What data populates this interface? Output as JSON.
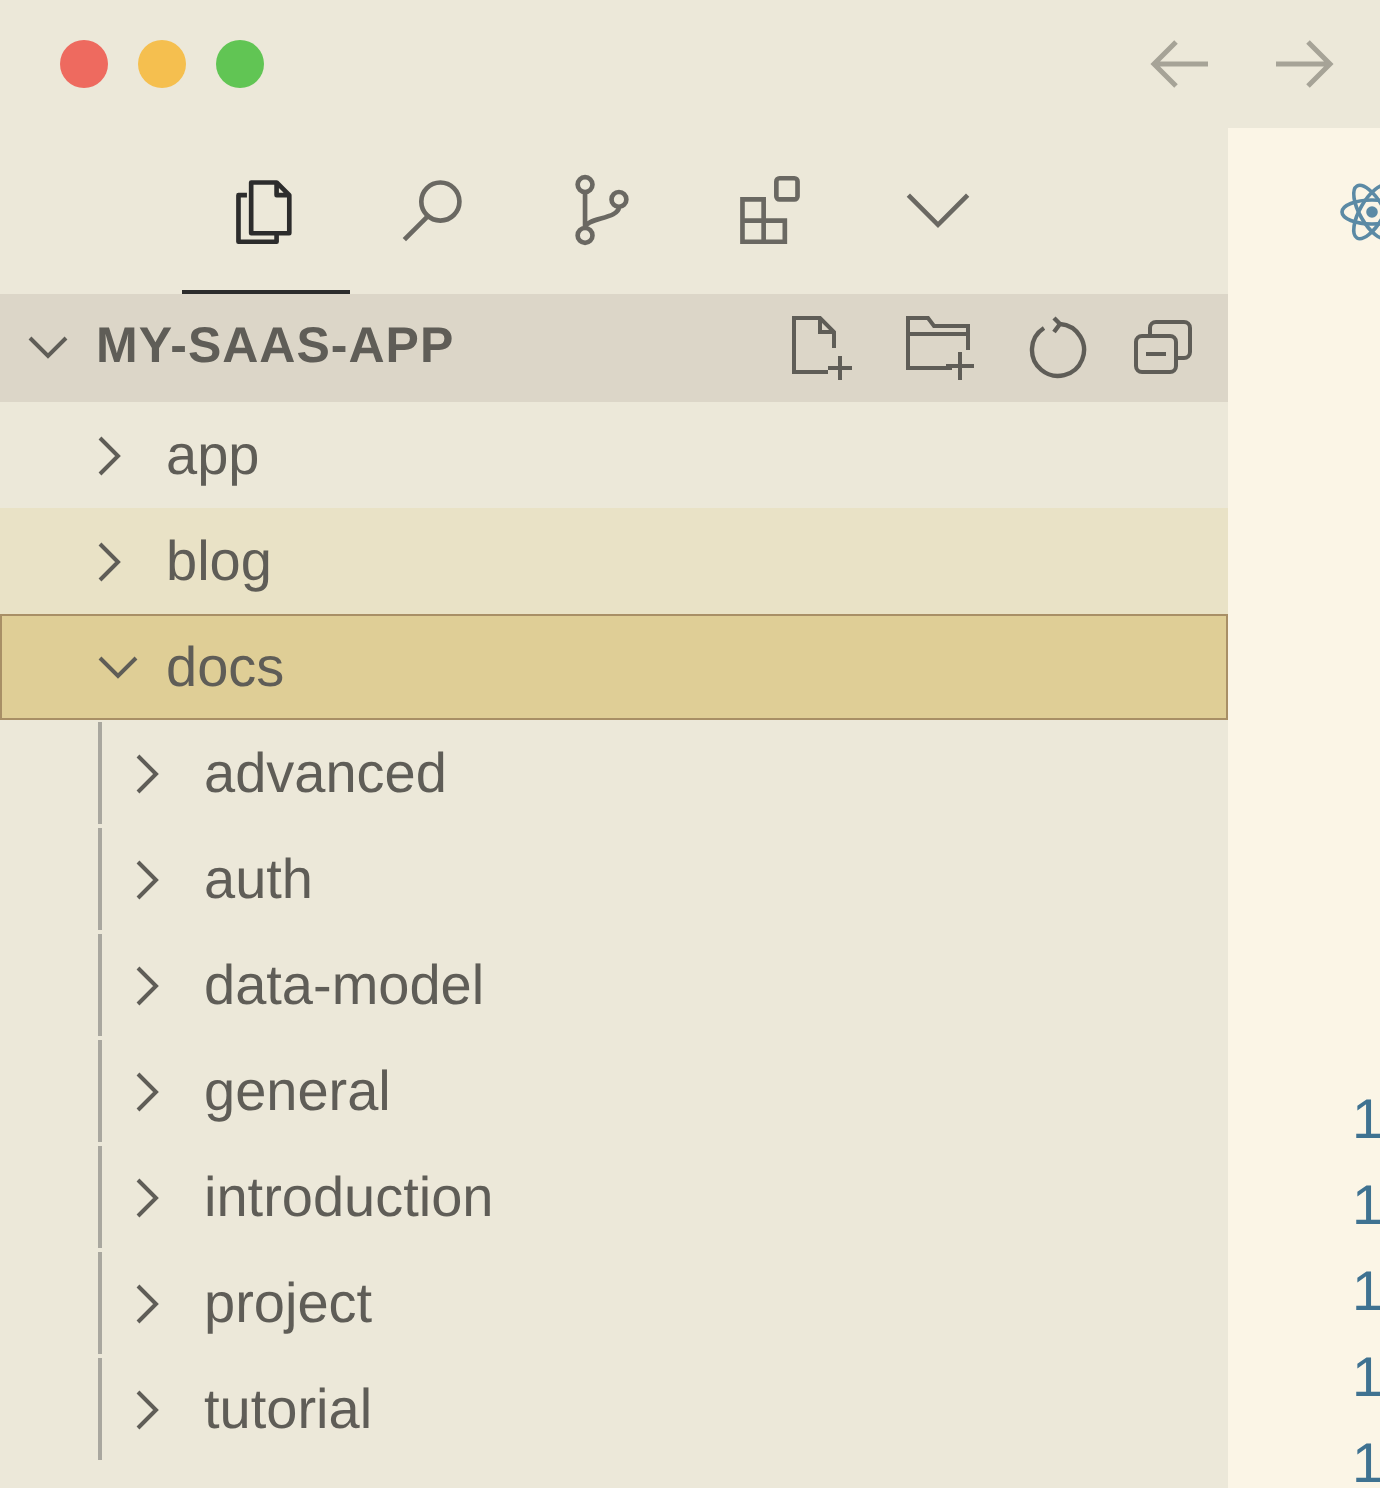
{
  "activity_tabs": [
    {
      "kind": "files",
      "selected": true
    },
    {
      "kind": "search",
      "selected": false
    },
    {
      "kind": "branch",
      "selected": false
    },
    {
      "kind": "extensions",
      "selected": false
    },
    {
      "kind": "more",
      "selected": false
    }
  ],
  "explorer": {
    "title": "MY-SAAS-APP",
    "expanded": true,
    "items": [
      {
        "label": "app",
        "expanded": false,
        "highlighted": false,
        "selected": false
      },
      {
        "label": "blog",
        "expanded": false,
        "highlighted": true,
        "selected": false
      },
      {
        "label": "docs",
        "expanded": true,
        "highlighted": false,
        "selected": true,
        "children": [
          {
            "label": "advanced",
            "expanded": false,
            "highlighted": false,
            "selected": false
          },
          {
            "label": "auth",
            "expanded": false,
            "highlighted": false,
            "selected": false
          },
          {
            "label": "data-model",
            "expanded": false,
            "highlighted": false,
            "selected": false
          },
          {
            "label": "general",
            "expanded": false,
            "highlighted": false,
            "selected": false
          },
          {
            "label": "introduction",
            "expanded": false,
            "highlighted": false,
            "selected": false
          },
          {
            "label": "project",
            "expanded": false,
            "highlighted": false,
            "selected": false
          },
          {
            "label": "tutorial",
            "expanded": false,
            "highlighted": false,
            "selected": false
          }
        ]
      }
    ]
  },
  "editor": {
    "line_numbers": [
      "1",
      "1",
      "1",
      "1",
      "1"
    ]
  }
}
